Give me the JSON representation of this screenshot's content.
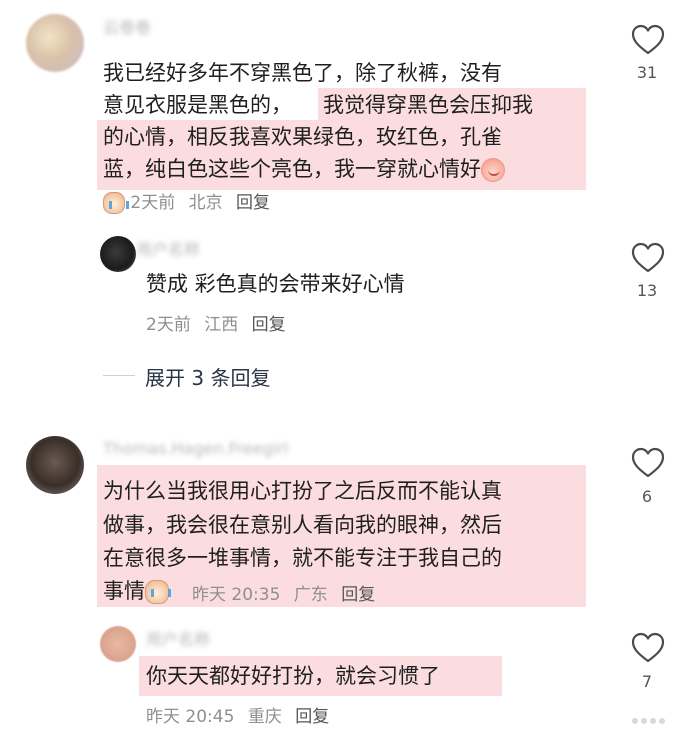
{
  "comments": [
    {
      "username": "云卷卷",
      "lines": [
        "我已经好多年不穿黑色了，除了秋裤，没有",
        "意见衣服是黑色的，",
        "我觉得穿黑色会压抑我",
        "的心情，相反我喜欢果绿色，玫红色，孔雀",
        "蓝，纯白色这些个亮色，我一穿就心情好"
      ],
      "time": "2天前",
      "location": "北京",
      "reply_label": "回复",
      "likes": "31",
      "emoji": "peach-face-emoji",
      "meta_emoji": "crying-face-emoji"
    },
    {
      "username": "用户名称",
      "text": "赞成 彩色真的会带来好心情",
      "time": "2天前",
      "location": "江西",
      "reply_label": "回复",
      "likes": "13"
    },
    {
      "username": "Thomas.Hagen.Freegirl",
      "lines": [
        "为什么当我很用心打扮了之后反而不能认真",
        "做事，我会很在意别人看向我的眼神，然后",
        "在意很多一堆事情，就不能专注于我自己的",
        "事情"
      ],
      "time": "昨天 20:35",
      "location": "广东",
      "reply_label": "回复",
      "likes": "6",
      "emoji": "crying-face-emoji"
    },
    {
      "username": "用户名称",
      "text": "你天天都好好打扮，就会习惯了",
      "time": "昨天 20:45",
      "location": "重庆",
      "reply_label": "回复",
      "likes": "7"
    }
  ],
  "expand_replies": "展开 3 条回复",
  "colors": {
    "highlight": "#fbdde0",
    "meta_text": "#8f8f8f",
    "body_text": "#1f1f1f"
  }
}
